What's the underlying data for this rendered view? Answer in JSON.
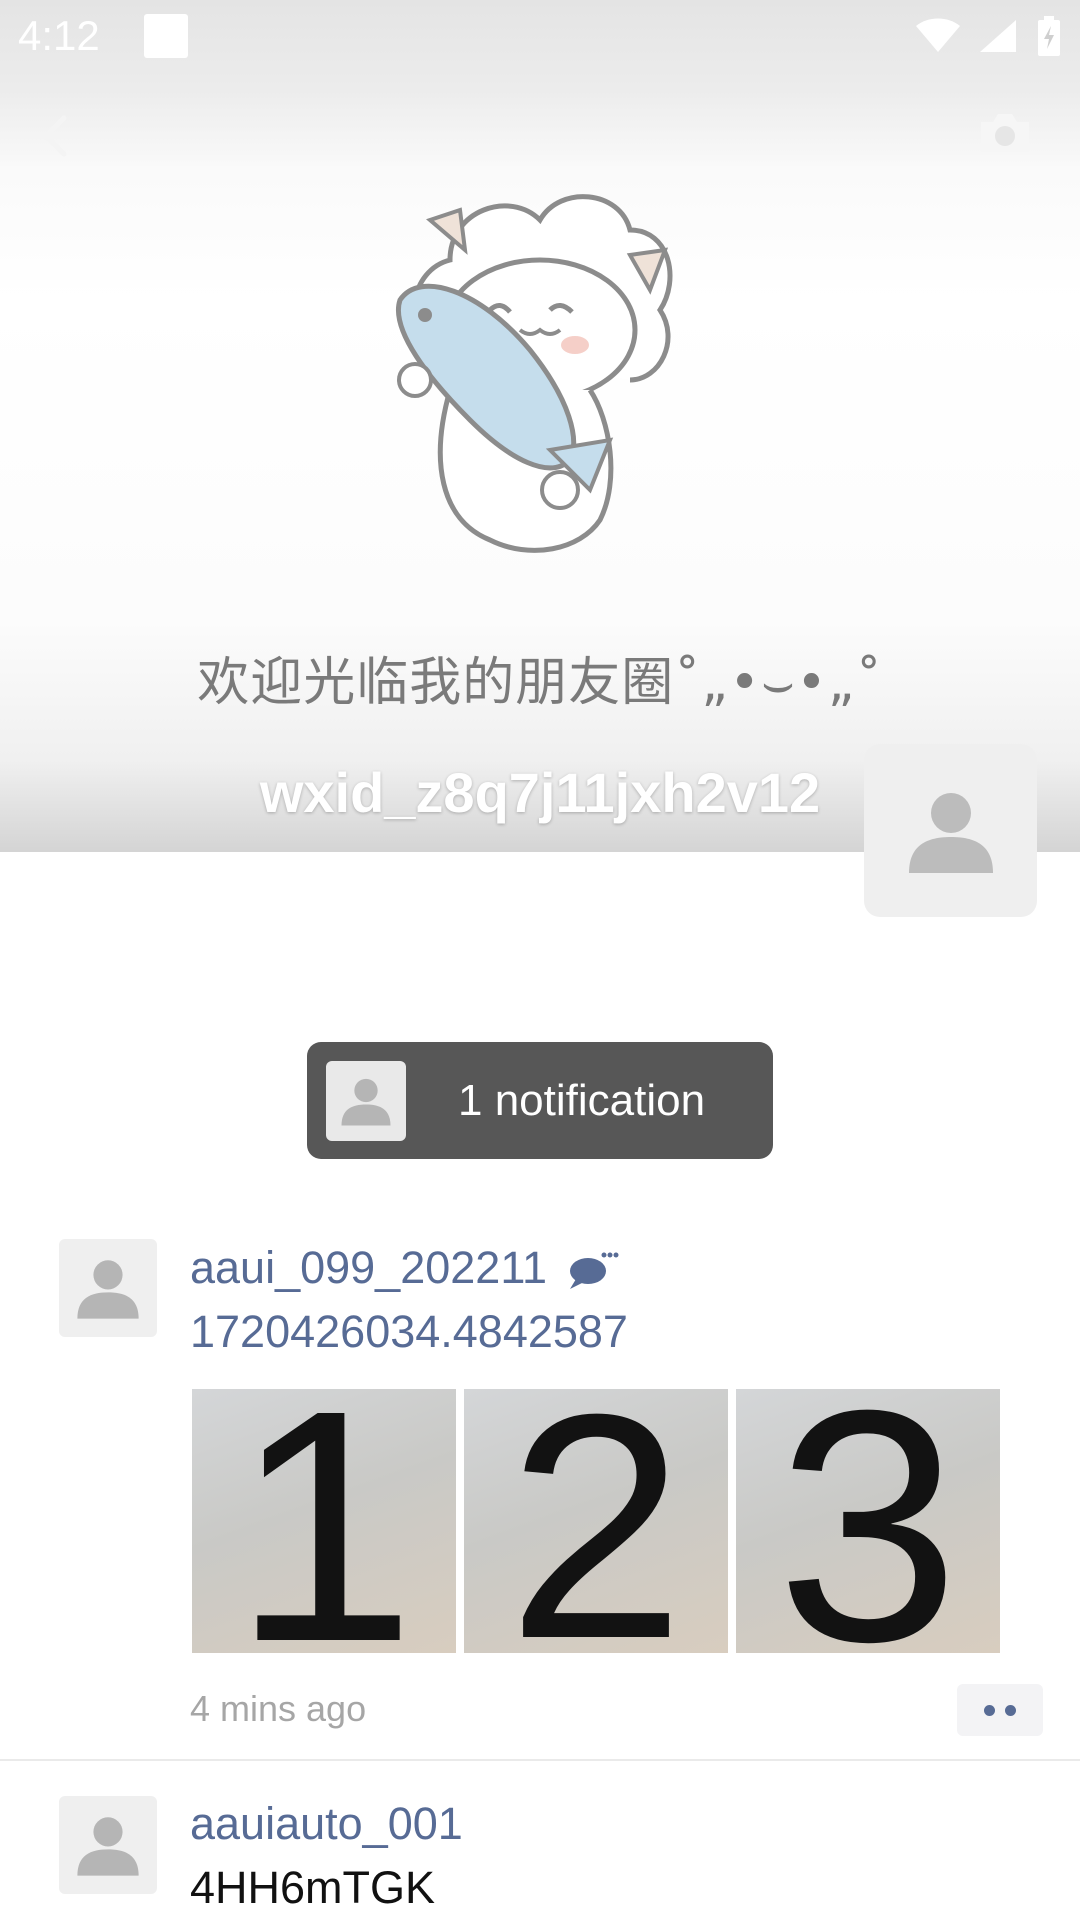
{
  "status_bar": {
    "time": "4:12",
    "icons": [
      "notification-square-icon",
      "wifi-icon",
      "cellular-signal-icon",
      "battery-charging-icon"
    ]
  },
  "nav": {
    "back_icon": "back-arrow-icon",
    "camera_icon": "camera-icon"
  },
  "cover": {
    "caption": "欢迎光临我的朋友圈˚„•⌣•„˚",
    "username": "wxid_z8q7j11jxh2v12"
  },
  "notification": {
    "text": "1 notification"
  },
  "feed": {
    "posts": [
      {
        "author": "aaui_099_202211",
        "author_badge_icon": "chat-bubble-icon",
        "text": "1720426034.4842587",
        "photos": [
          "1",
          "2",
          "3"
        ],
        "time": "4 mins ago"
      },
      {
        "author": "aauiauto_001",
        "text": "4HH6mTGK"
      }
    ]
  },
  "colors": {
    "link_blue": "#576b95",
    "notification_bg": "#575757",
    "avatar_placeholder": "#efefef",
    "timestamp_gray": "#a6a6a6"
  }
}
